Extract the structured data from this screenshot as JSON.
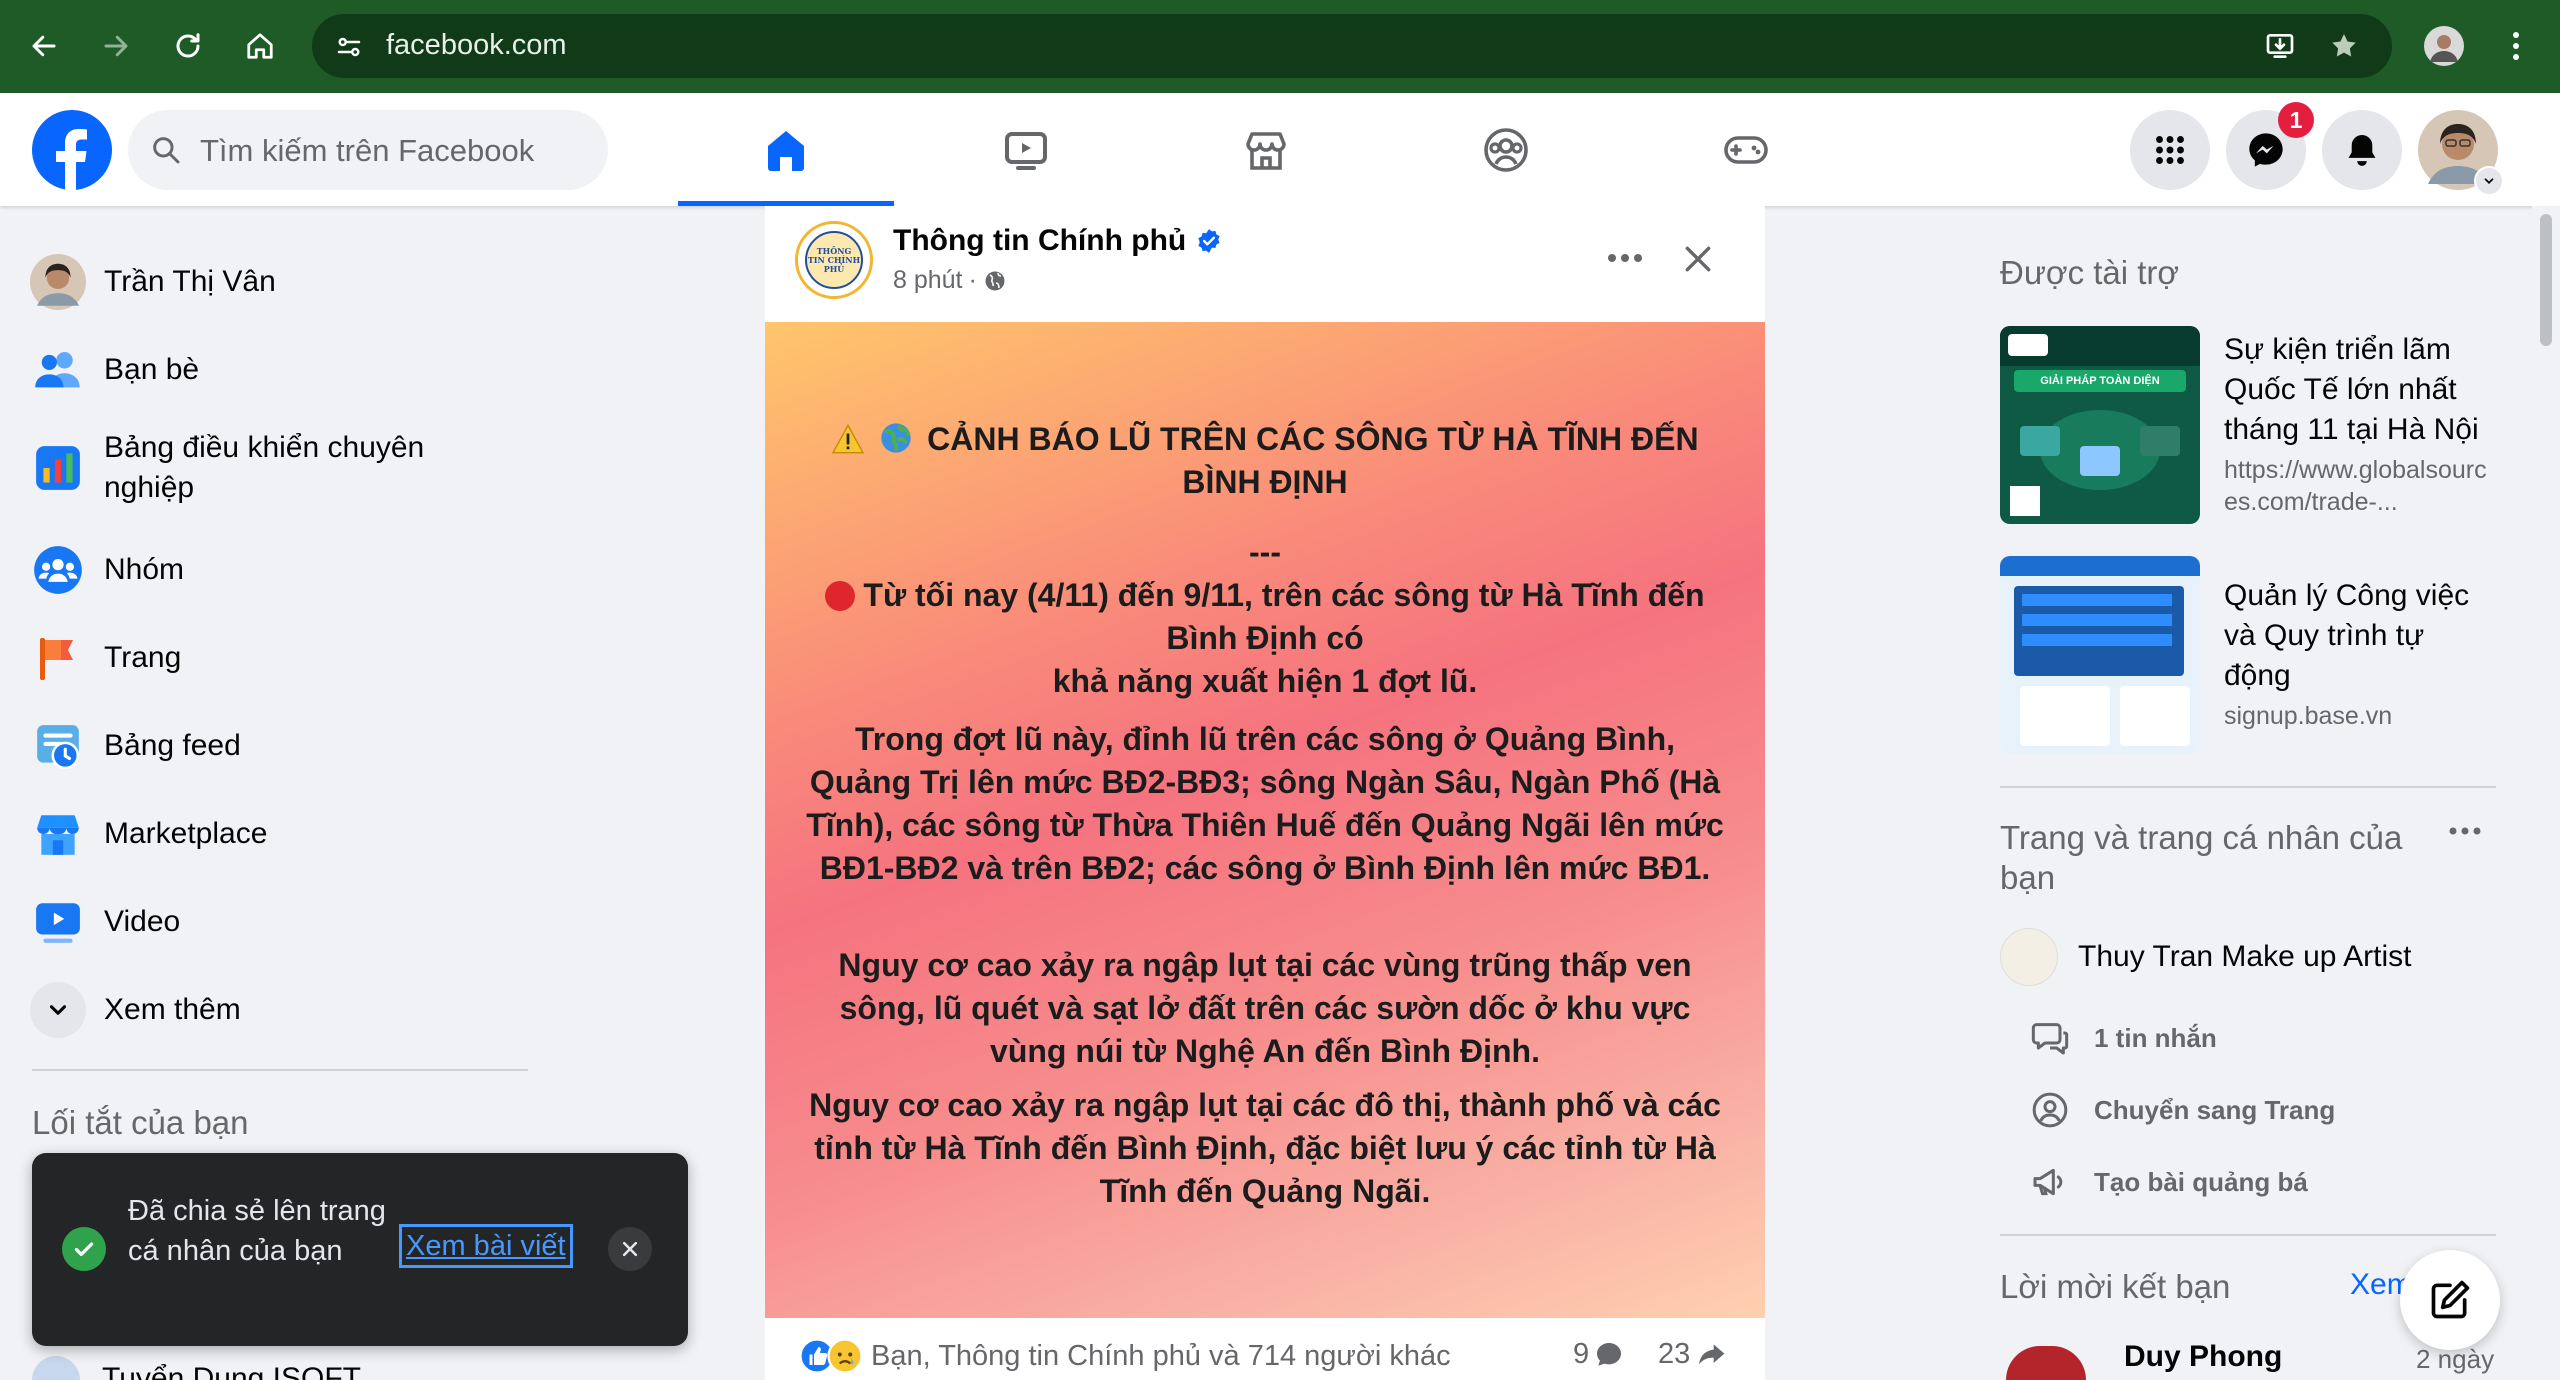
{
  "browser": {
    "url": "facebook.com"
  },
  "header": {
    "search_placeholder": "Tìm kiếm trên Facebook",
    "messenger_badge": "1"
  },
  "left_nav": {
    "items": [
      {
        "label": "Trần Thị Vân"
      },
      {
        "label": "Bạn bè"
      },
      {
        "label": "Bảng điều khiển chuyên nghiệp"
      },
      {
        "label": "Nhóm"
      },
      {
        "label": "Trang"
      },
      {
        "label": "Bảng feed"
      },
      {
        "label": "Marketplace"
      },
      {
        "label": "Video"
      },
      {
        "label": "Xem thêm"
      }
    ],
    "shortcuts_title": "Lối tắt của bạn",
    "partial_shortcut": "Tuyển Dụng ISOFT"
  },
  "post": {
    "author": "Thông tin Chính phủ",
    "logo_text": "THÔNG TIN CHÍNH PHỦ",
    "time": "8 phút",
    "dot": "·",
    "headline": "CẢNH BÁO LŨ TRÊN CÁC SÔNG TỪ HÀ TĨNH ĐẾN BÌNH ĐỊNH",
    "separator": "---",
    "para1_line1": "Từ tối nay (4/11) đến 9/11, trên các sông từ Hà Tĩnh đến Bình Định có",
    "para1_line2": "khả năng xuất hiện 1 đợt lũ.",
    "para2": "Trong đợt lũ này, đỉnh lũ trên các sông ở Quảng Bình, Quảng Trị lên mức BĐ2-BĐ3; sông Ngàn Sâu, Ngàn Phố (Hà Tĩnh), các sông từ Thừa Thiên Huế đến Quảng Ngãi lên mức BĐ1-BĐ2 và trên BĐ2; các sông ở Bình Định lên mức BĐ1.",
    "para3": "Nguy cơ cao xảy ra ngập lụt tại các vùng trũng thấp ven sông, lũ quét và sạt lở đất trên các sườn dốc ở khu vực vùng núi từ Nghệ An đến Bình Định.",
    "para4": "Nguy cơ cao xảy ra ngập lụt tại các đô thị, thành phố và các tỉnh từ Hà Tĩnh đến Bình Định, đặc biệt lưu ý các tỉnh từ Hà Tĩnh đến Quảng Ngãi.",
    "reactions_text": "Bạn, Thông tin Chính phủ và 714 người khác",
    "comments": "9",
    "shares": "23"
  },
  "right": {
    "sponsored_title": "Được tài trợ",
    "ads": [
      {
        "title": "Sự kiện triển lãm Quốc Tế lớn nhất tháng 11 tại Hà Nội",
        "url": "https://www.globalsources.com/trade-...",
        "thumb_caption": "GIẢI PHÁP TOÀN DIỆN"
      },
      {
        "title": "Quản lý Công việc và Quy trình tự động",
        "url": "signup.base.vn"
      }
    ],
    "pages_title": "Trang và trang cá nhân của bạn",
    "page_name": "Thuy Tran Make up Artist",
    "page_actions": [
      {
        "label": "1 tin nhắn"
      },
      {
        "label": "Chuyển sang Trang"
      },
      {
        "label": "Tạo bài quảng bá"
      }
    ],
    "friend_requests_title": "Lời mời kết bạn",
    "see_all": "Xem",
    "request_name": "Duy Phong",
    "request_time": "2 ngày"
  },
  "toast": {
    "message": "Đã chia sẻ lên trang cá nhân của bạn",
    "link": "Xem bài viết"
  },
  "colors": {
    "fb_blue": "#0866ff",
    "chrome_green": "#1e5b27",
    "badge_red": "#e41e3f",
    "success_green": "#31a24c"
  }
}
